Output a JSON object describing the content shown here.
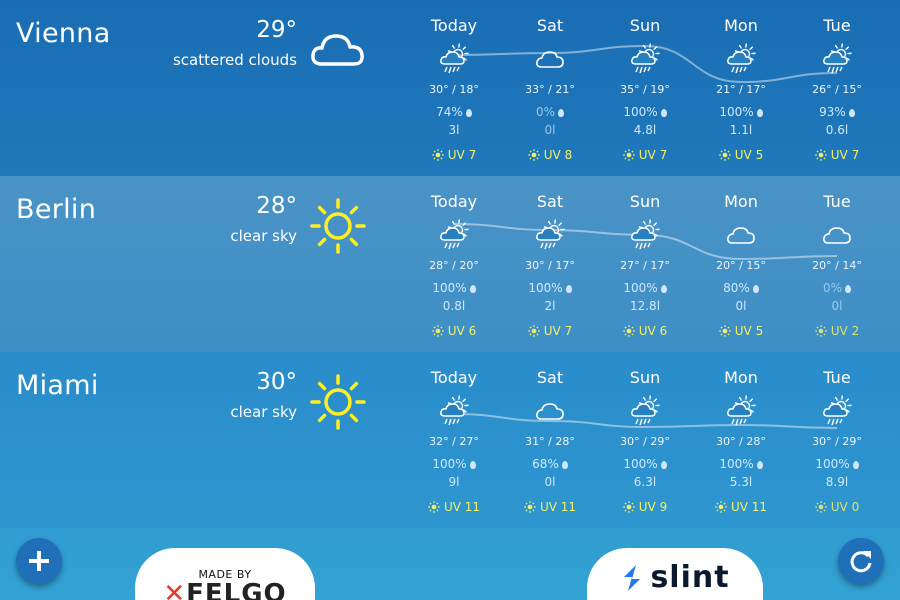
{
  "cities": [
    {
      "name": "Vienna",
      "temp": "29°",
      "desc": "scattered clouds",
      "icon": "cloud-icon",
      "days": [
        {
          "name": "Today",
          "icon": "rain-cloud-sun-icon",
          "temps": "30° / 18°",
          "prob": "74%",
          "amt": "3l",
          "uv": "UV 7",
          "dim": false,
          "trend": 0.35
        },
        {
          "name": "Sat",
          "icon": "cloud-small-icon",
          "temps": "33° / 21°",
          "prob": "0%",
          "amt": "0l",
          "uv": "UV 8",
          "dim": true,
          "trend": 0.33
        },
        {
          "name": "Sun",
          "icon": "rain-cloud-sun-icon",
          "temps": "35° / 19°",
          "prob": "100%",
          "amt": "4.8l",
          "uv": "UV 7",
          "dim": false,
          "trend": 0.26
        },
        {
          "name": "Mon",
          "icon": "rain-cloud-sun-icon",
          "temps": "21° / 17°",
          "prob": "100%",
          "amt": "1.1l",
          "uv": "UV 5",
          "dim": false,
          "trend": 0.62
        },
        {
          "name": "Tue",
          "icon": "rain-cloud-sun-icon",
          "temps": "26° / 15°",
          "prob": "93%",
          "amt": "0.6l",
          "uv": "UV 7",
          "dim": false,
          "trend": 0.53
        }
      ]
    },
    {
      "name": "Berlin",
      "temp": "28°",
      "desc": "clear sky",
      "icon": "sun-icon",
      "days": [
        {
          "name": "Today",
          "icon": "rain-cloud-sun-icon",
          "temps": "28° / 20°",
          "prob": "100%",
          "amt": "0.8l",
          "uv": "UV 6",
          "dim": false,
          "trend": 0.28
        },
        {
          "name": "Sat",
          "icon": "rain-cloud-sun-icon",
          "temps": "30° / 17°",
          "prob": "100%",
          "amt": "2l",
          "uv": "UV 7",
          "dim": false,
          "trend": 0.34
        },
        {
          "name": "Sun",
          "icon": "rain-cloud-sun-icon",
          "temps": "27° / 17°",
          "prob": "100%",
          "amt": "12.8l",
          "uv": "UV 6",
          "dim": false,
          "trend": 0.39
        },
        {
          "name": "Mon",
          "icon": "cloud-small-icon",
          "temps": "20° / 15°",
          "prob": "80%",
          "amt": "0l",
          "uv": "UV 5",
          "dim": false,
          "trend": 0.63
        },
        {
          "name": "Tue",
          "icon": "cloud-small-icon",
          "temps": "20° / 14°",
          "prob": "0%",
          "amt": "0l",
          "uv": "UV 2",
          "dim": true,
          "trend": 0.6
        }
      ]
    },
    {
      "name": "Miami",
      "temp": "30°",
      "desc": "clear sky",
      "icon": "sun-icon",
      "days": [
        {
          "name": "Today",
          "icon": "rain-cloud-sun-icon",
          "temps": "32° / 27°",
          "prob": "100%",
          "amt": "9l",
          "uv": "UV 11",
          "dim": false,
          "trend": 0.42
        },
        {
          "name": "Sat",
          "icon": "cloud-small-icon",
          "temps": "31° / 28°",
          "prob": "68%",
          "amt": "0l",
          "uv": "UV 11",
          "dim": false,
          "trend": 0.49
        },
        {
          "name": "Sun",
          "icon": "rain-cloud-sun-icon",
          "temps": "30° / 29°",
          "prob": "100%",
          "amt": "6.3l",
          "uv": "UV 9",
          "dim": false,
          "trend": 0.55
        },
        {
          "name": "Mon",
          "icon": "rain-cloud-sun-icon",
          "temps": "30° / 28°",
          "prob": "100%",
          "amt": "5.3l",
          "uv": "UV 11",
          "dim": false,
          "trend": 0.53
        },
        {
          "name": "Tue",
          "icon": "rain-cloud-sun-icon",
          "temps": "30° / 29°",
          "prob": "100%",
          "amt": "8.9l",
          "uv": "UV 0",
          "dim": false,
          "trend": 0.56
        }
      ]
    }
  ],
  "footer": {
    "felgo_small": "MADE BY",
    "felgo_logo": "FELGO",
    "slint_logo": "slint"
  },
  "colors": {
    "uv": "#f5f06a",
    "sun": "#ffee22",
    "accent": "#1f6fb9"
  }
}
